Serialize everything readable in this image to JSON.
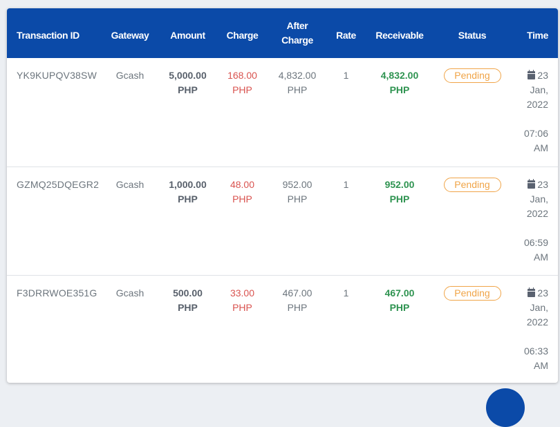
{
  "table": {
    "headers": {
      "transaction_id": "Transaction ID",
      "gateway": "Gateway",
      "amount": "Amount",
      "charge": "Charge",
      "after_charge_line1": "After",
      "after_charge_line2": "Charge",
      "rate": "Rate",
      "receivable": "Receivable",
      "status": "Status",
      "time": "Time"
    },
    "rows": [
      {
        "transaction_id": "YK9KUPQV38SW",
        "gateway": "Gcash",
        "amount": "5,000.00",
        "charge": "168.00",
        "after_charge": "4,832.00",
        "rate": "1",
        "receivable": "4,832.00",
        "currency": "PHP",
        "status": "Pending",
        "day": "23",
        "month": "Jan,",
        "year": "2022",
        "clock": "07:06",
        "meridiem": "AM"
      },
      {
        "transaction_id": "GZMQ25DQEGR2",
        "gateway": "Gcash",
        "amount": "1,000.00",
        "charge": "48.00",
        "after_charge": "952.00",
        "rate": "1",
        "receivable": "952.00",
        "currency": "PHP",
        "status": "Pending",
        "day": "23",
        "month": "Jan,",
        "year": "2022",
        "clock": "06:59",
        "meridiem": "AM"
      },
      {
        "transaction_id": "F3DRRWOE351G",
        "gateway": "Gcash",
        "amount": "500.00",
        "charge": "33.00",
        "after_charge": "467.00",
        "rate": "1",
        "receivable": "467.00",
        "currency": "PHP",
        "status": "Pending",
        "day": "23",
        "month": "Jan,",
        "year": "2022",
        "clock": "06:33",
        "meridiem": "AM"
      }
    ]
  },
  "icons": {
    "time": "calendar-icon"
  },
  "colors": {
    "header_bg": "#0b4aa8",
    "charge": "#d9534f",
    "receivable": "#2e9350",
    "pending": "#f0a447"
  }
}
